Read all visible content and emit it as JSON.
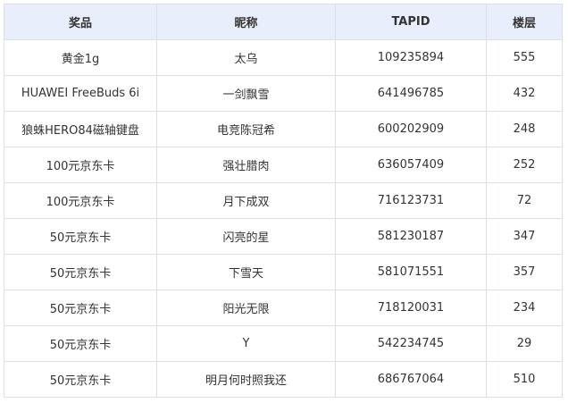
{
  "table": {
    "header_bg": "#e8eefb",
    "border_color": "#dcdfe6",
    "columns": [
      "奖品",
      "昵称",
      "TAPID",
      "楼层"
    ],
    "rows": [
      [
        "黄金1g",
        "太乌",
        "109235894",
        "555"
      ],
      [
        "HUAWEI FreeBuds 6i",
        "一剑飘雪",
        "641496785",
        "432"
      ],
      [
        "狼蛛HERO84磁轴键盘",
        "电竞陈冠希",
        "600202909",
        "248"
      ],
      [
        "100元京东卡",
        "强壮腊肉",
        "636057409",
        "252"
      ],
      [
        "100元京东卡",
        "月下成双",
        "716123731",
        "72"
      ],
      [
        "50元京东卡",
        "闪亮的星",
        "581230187",
        "347"
      ],
      [
        "50元京东卡",
        "下雪天",
        "581071551",
        "357"
      ],
      [
        "50元京东卡",
        "阳光无限",
        "718120031",
        "234"
      ],
      [
        "50元京东卡",
        "Y",
        "542234745",
        "29"
      ],
      [
        "50元京东卡",
        "明月何时照我还",
        "686767064",
        "510"
      ]
    ]
  }
}
